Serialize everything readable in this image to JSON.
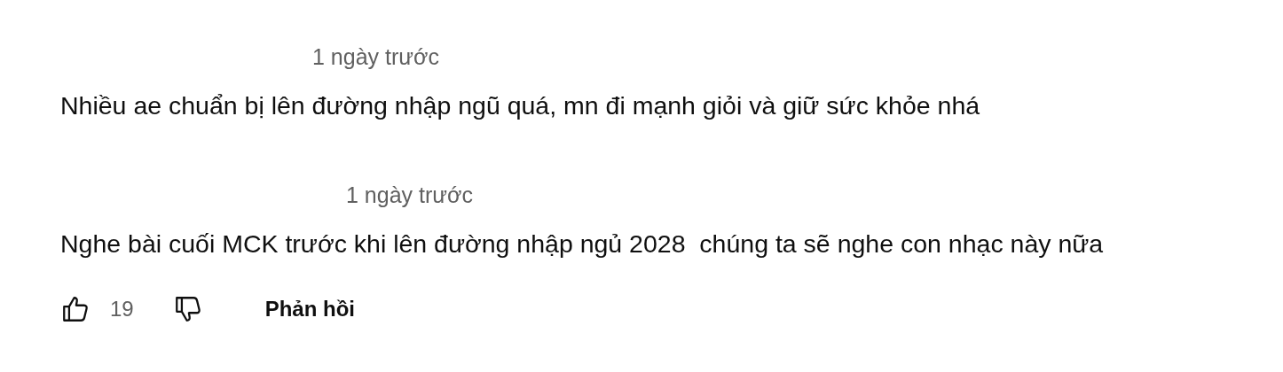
{
  "comments": [
    {
      "time": "1 ngày trước",
      "text": "Nhiều ae chuẩn bị lên đường nhập ngũ quá, mn đi mạnh giỏi và giữ sức khỏe nhá"
    },
    {
      "time": "1 ngày trước",
      "text": "Nghe bài cuối MCK trước khi lên đường nhập ngủ 2028  chúng ta sẽ nghe con nhạc này nữa",
      "actions": {
        "likes": "19",
        "reply": "Phản hồi"
      }
    }
  ]
}
